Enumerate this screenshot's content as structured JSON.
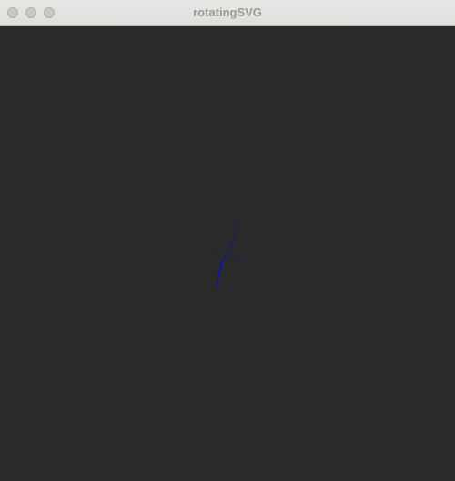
{
  "window": {
    "title": "rotatingSVG",
    "controls": [
      "close-button",
      "minimize-button",
      "zoom-button"
    ]
  },
  "canvas": {
    "background": "#2a2a2a",
    "shape": {
      "name": "four-point-star",
      "fill": "#0014bf",
      "rotation_deg": 15
    }
  }
}
